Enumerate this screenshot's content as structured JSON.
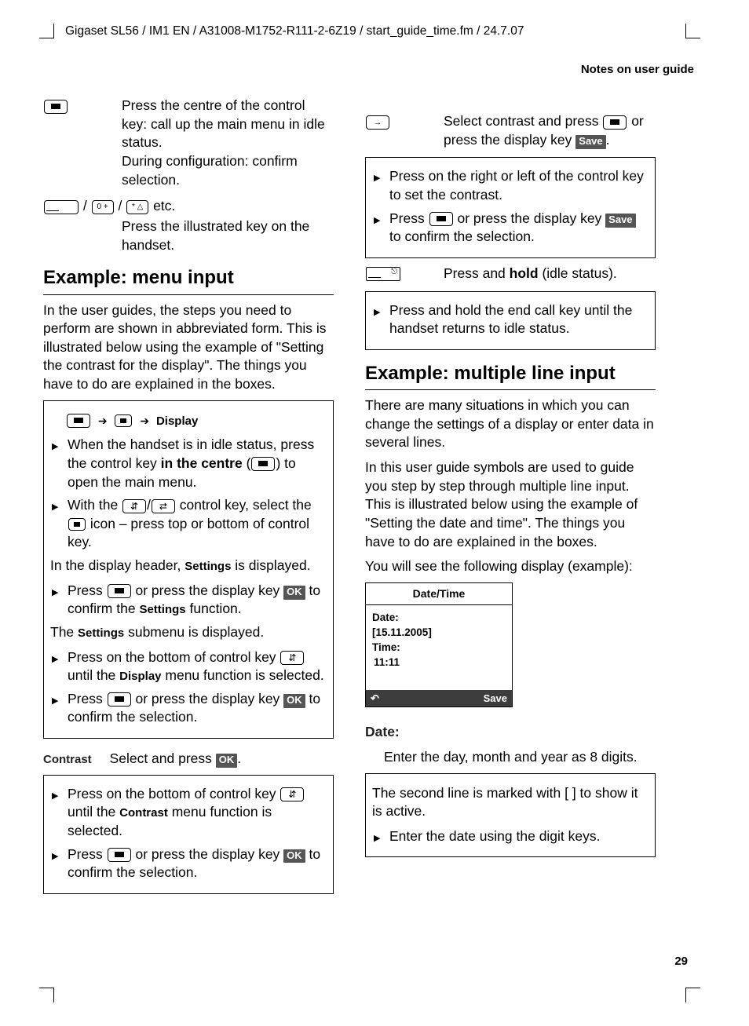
{
  "header": {
    "path": "Gigaset SL56 / IM1 EN / A31008-M1752-R111-2-6Z19 / start_guide_time.fm / 24.7.07",
    "section": "Notes on user guide"
  },
  "left": {
    "step1": "Press the centre of the control key: call up the main menu in idle status.",
    "step1b": "During configuration: confirm selection.",
    "step2suffix": " etc.",
    "step2text": "Press the illustrated key on the handset.",
    "h_menu": "Example: menu input",
    "p_menu": "In the user guides, the steps you need to perform are shown in abbreviated form. This is illustrated below using the example of \"Setting the contrast for the display\". The things you have to do are explained in the boxes.",
    "nav_display": "Display",
    "box1": {
      "l1a": "When the handset is in idle status, press the control key ",
      "l1b": "in the centre",
      "l1c": ") to open the main menu.",
      "l2a": "With the ",
      "l2b": " control key, select the ",
      "l2c": " icon – press top or bottom of control key.",
      "l3a": "In the display header, ",
      "l3b": "Settings",
      "l3c": "  is displayed.",
      "l4a": "Press ",
      "l4b": " or press the display key ",
      "l4c": " to confirm the ",
      "l4d": "Settings",
      "l4e": "  function.",
      "l5a": "The ",
      "l5b": "Settings",
      "l5c": "  submenu is displayed.",
      "l6a": "Press on the bottom of control key ",
      "l6b": " until the ",
      "l6c": "Display",
      "l6d": " menu function is selected.",
      "l7a": "Press ",
      "l7b": " or press the display key ",
      "l7c": " to confirm the selection."
    },
    "contrast_label": "Contrast",
    "contrast_text": "Select and press ",
    "box2": {
      "l1a": "Press on the bottom of control key ",
      "l1b": " until the ",
      "l1c": "Contrast",
      "l1d": " menu function is selected.",
      "l2a": "Press ",
      "l2b": " or press the display key ",
      "l2c": " to confirm the selection."
    }
  },
  "right": {
    "step1a": "Select contrast and press ",
    "step1b": "or press the display key ",
    "box1": {
      "l1": "Press on the right or left of the control key to set the contrast.",
      "l2a": "Press ",
      "l2b": " or press the display key ",
      "l2c": " to confirm the selection."
    },
    "step2a": "Press and ",
    "step2b": "hold",
    "step2c": " (idle status).",
    "box2": {
      "l1": "Press and hold the end call key until the handset returns to idle status."
    },
    "h_multi": "Example: multiple line input",
    "p1": "There are many situations in which you can change the settings of a display or enter data in several lines.",
    "p2": "In this user guide symbols are used to guide you step by step through multiple line input. This is illustrated below using the example of \"Setting the date and time\". The things you have to do are explained in the boxes.",
    "p3": "You will see the following display (example):",
    "phone": {
      "title": "Date/Time",
      "date_label": "Date:",
      "date_val": "[15.11.2005]",
      "time_label": "Time:",
      "time_val": "11:11",
      "undo_icon": "↶",
      "save": "Save"
    },
    "date_label": "Date:",
    "date_text": "Enter the day, month and year as 8 digits.",
    "box3": {
      "l1": "The second line is marked with [  ] to show it is active.",
      "l2": "Enter the date using the digit keys."
    }
  },
  "labels": {
    "ok": "OK",
    "save": "Save"
  },
  "page_number": "29"
}
